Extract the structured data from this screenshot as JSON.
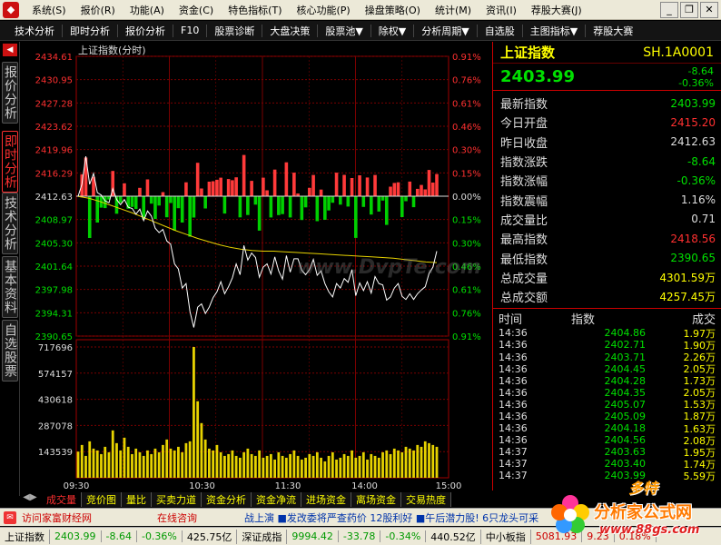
{
  "app": {
    "menu": [
      "系统(S)",
      "报价(R)",
      "功能(A)",
      "资金(C)",
      "特色指标(T)",
      "核心功能(P)",
      "操盘策略(O)",
      "统计(M)",
      "资讯(I)",
      "荐股大赛(J)"
    ],
    "toolbar": [
      "技术分析",
      "即时分析",
      "报价分析",
      "F10",
      "股票诊断",
      "大盘决策",
      "股票池▼",
      "除权▼",
      "分析周期▼",
      "自选股",
      "主图指标▼",
      "荐股大赛"
    ],
    "side_tabs": [
      "报价分析",
      "即时分析",
      "技术分析",
      "基本资料",
      "自选股票"
    ]
  },
  "chart": {
    "title": "上证指数(分时)",
    "watermark": "www.DvpTe.com",
    "price_ticks": [
      "2434.61",
      "2430.95",
      "2427.28",
      "2423.62",
      "2419.96",
      "2416.29",
      "2412.63",
      "2408.97",
      "2405.30",
      "2401.64",
      "2397.98",
      "2394.31",
      "2390.65"
    ],
    "pct_ticks": [
      "0.91%",
      "0.76%",
      "0.61%",
      "0.46%",
      "0.30%",
      "0.15%",
      "0.00%",
      "0.15%",
      "0.30%",
      "0.46%",
      "0.61%",
      "0.76%",
      "0.91%"
    ],
    "volume_ticks": [
      "717696",
      "574157",
      "430618",
      "287078",
      "143539"
    ],
    "time_ticks": [
      "09:30",
      "10:30",
      "11:30",
      "14:00",
      "15:00"
    ]
  },
  "chart_data": {
    "type": "line",
    "title": "上证指数(分时)",
    "xlabel": "",
    "ylabel": "",
    "x": [
      "09:30",
      "10:30",
      "11:30",
      "14:00",
      "15:00"
    ],
    "ylim": [
      2390.65,
      2434.61
    ],
    "prev_close": 2412.63,
    "price_series": [
      2412.6,
      2414.5,
      2418.9,
      2414.5,
      2416.2,
      2413.2,
      2412.8,
      2411.9,
      2411.6,
      2413.8,
      2412.1,
      2411.3,
      2412.1,
      2410.9,
      2410.7,
      2409.8,
      2410.6,
      2408.8,
      2410.3,
      2409.5,
      2407.6,
      2406.9,
      2407.4,
      2405.6,
      2405.1,
      2402.0,
      2401.2,
      2398.2,
      2398.9,
      2394.5,
      2392.0,
      2395.2,
      2395.7,
      2394.2,
      2395.2,
      2396.7,
      2397.6,
      2399.2,
      2397.3,
      2398.4,
      2399.8,
      2402.0,
      2400.3,
      2404.9,
      2402.6,
      2403.7,
      2403.0,
      2399.9,
      2401.5,
      2402.0,
      2400.4,
      2403.1,
      2400.9,
      2399.6,
      2403.3,
      2400.7,
      2402.8,
      2402.8,
      2401.0,
      2400.3,
      2401.1,
      2402.7,
      2400.2,
      2400.9,
      2398.9,
      2397.6,
      2396.8,
      2398.9,
      2398.2,
      2399.7,
      2399.1,
      2401.1,
      2397.0,
      2399.0,
      2397.8,
      2399.2,
      2397.4,
      2400.0,
      2398.9,
      2398.7,
      2396.3,
      2396.8,
      2398.2,
      2398.9,
      2396.9,
      2396.4,
      2397.3,
      2396.4,
      2397.3,
      2397.9,
      2398.4,
      2400.5,
      2401.5,
      2403.99
    ],
    "avg_series": [
      2412.6,
      2412.3,
      2411.8,
      2411.2,
      2410.6,
      2410.0,
      2409.3,
      2408.6,
      2407.9,
      2407.2,
      2406.6,
      2406.0,
      2405.5,
      2405.0,
      2404.6,
      2404.3,
      2404.1,
      2404.0,
      2404.0,
      2403.9,
      2403.8,
      2403.7,
      2403.6,
      2403.5,
      2403.4,
      2403.3,
      2403.2,
      2403.1,
      2403.0,
      2402.9,
      2402.7,
      2402.5,
      2402.3,
      2402.2
    ],
    "volume_series": [
      143539,
      180000,
      120000,
      200000,
      160000,
      150000,
      130000,
      170000,
      140000,
      260000,
      190000,
      150000,
      220000,
      170000,
      130000,
      160000,
      140000,
      120000,
      150000,
      130000,
      160000,
      140000,
      180000,
      210000,
      160000,
      150000,
      170000,
      140000,
      190000,
      200000,
      717696,
      420000,
      300000,
      210000,
      160000,
      150000,
      180000,
      140000,
      120000,
      130000,
      150000,
      120000,
      110000,
      140000,
      160000,
      130000,
      120000,
      150000,
      110000,
      120000,
      130000,
      100000,
      140000,
      120000,
      110000,
      130000,
      150000,
      120000,
      100000,
      110000,
      130000,
      120000,
      140000,
      110000,
      90000,
      120000,
      140000,
      100000,
      110000,
      130000,
      120000,
      150000,
      110000,
      120000,
      140000,
      100000,
      130000,
      120000,
      110000,
      140000,
      150000,
      130000,
      160000,
      150000,
      140000,
      170000,
      160000,
      150000,
      180000,
      170000,
      200000,
      190000,
      180000,
      170000
    ]
  },
  "info": {
    "name": "上证指数",
    "code": "SH.1A0001",
    "price": "2403.99",
    "change": "-8.64",
    "change_pct": "-0.36%",
    "stats": [
      {
        "label": "最新指数",
        "value": "2403.99",
        "color": "#00e000"
      },
      {
        "label": "今日开盘",
        "value": "2415.20",
        "color": "#ff3030"
      },
      {
        "label": "昨日收盘",
        "value": "2412.63",
        "color": "#dddddd"
      },
      {
        "label": "指数涨跌",
        "value": "-8.64",
        "color": "#00e000"
      },
      {
        "label": "指数涨幅",
        "value": "-0.36%",
        "color": "#00e000"
      },
      {
        "label": "指数震幅",
        "value": "1.16%",
        "color": "#dddddd"
      },
      {
        "label": "成交量比",
        "value": "0.71",
        "color": "#dddddd"
      },
      {
        "label": "最高指数",
        "value": "2418.56",
        "color": "#ff3030"
      },
      {
        "label": "最低指数",
        "value": "2390.65",
        "color": "#00e000"
      },
      {
        "label": "总成交量",
        "value": "4301.59万",
        "color": "#ffff00"
      },
      {
        "label": "总成交额",
        "value": "4257.45万",
        "color": "#ffff00"
      }
    ],
    "ticks_header": [
      "时间",
      "指数",
      "成交"
    ],
    "ticks": [
      [
        "14:36",
        "2404.86",
        "1.97万"
      ],
      [
        "14:36",
        "2402.71",
        "1.90万"
      ],
      [
        "14:36",
        "2403.71",
        "2.26万"
      ],
      [
        "14:36",
        "2404.45",
        "2.05万"
      ],
      [
        "14:36",
        "2404.28",
        "1.73万"
      ],
      [
        "14:36",
        "2404.35",
        "2.05万"
      ],
      [
        "14:36",
        "2405.07",
        "1.53万"
      ],
      [
        "14:36",
        "2405.09",
        "1.87万"
      ],
      [
        "14:36",
        "2404.18",
        "1.63万"
      ],
      [
        "14:36",
        "2404.56",
        "2.08万"
      ],
      [
        "14:37",
        "2403.63",
        "1.95万"
      ],
      [
        "14:37",
        "2403.40",
        "1.74万"
      ],
      [
        "14:37",
        "2403.99",
        "5.59万"
      ]
    ]
  },
  "bottom_tabs": [
    "成交量",
    "竞价图",
    "量比",
    "买卖力道",
    "资金分析",
    "资金净流",
    "进场资金",
    "离场资金",
    "交易热度"
  ],
  "news": {
    "link1": "访问家富财经网",
    "link2": "在线咨询",
    "ticker": "战上演  ■发改委将严查药价  12股利好  ■午后潜力股!  6只龙头可采"
  },
  "status": [
    {
      "text": "上证指数",
      "color": "#000000"
    },
    {
      "text": "2403.99",
      "color": "#009900"
    },
    {
      "text": "-8.64",
      "color": "#009900"
    },
    {
      "text": "-0.36%",
      "color": "#009900"
    },
    {
      "text": "425.75亿",
      "color": "#000000"
    },
    {
      "text": "深证成指",
      "color": "#000000"
    },
    {
      "text": "9994.42",
      "color": "#009900"
    },
    {
      "text": "-33.78",
      "color": "#009900"
    },
    {
      "text": "-0.34%",
      "color": "#009900"
    },
    {
      "text": "440.52亿",
      "color": "#000000"
    },
    {
      "text": "中小板指",
      "color": "#000000"
    },
    {
      "text": "5081.93",
      "color": "#cc0000"
    },
    {
      "text": "9.23",
      "color": "#cc0000"
    },
    {
      "text": "0.18%",
      "color": "#cc0000"
    }
  ],
  "watermark_logo": {
    "top": "多特",
    "main": "分析家公式网",
    "url": "www.88gs.com"
  }
}
